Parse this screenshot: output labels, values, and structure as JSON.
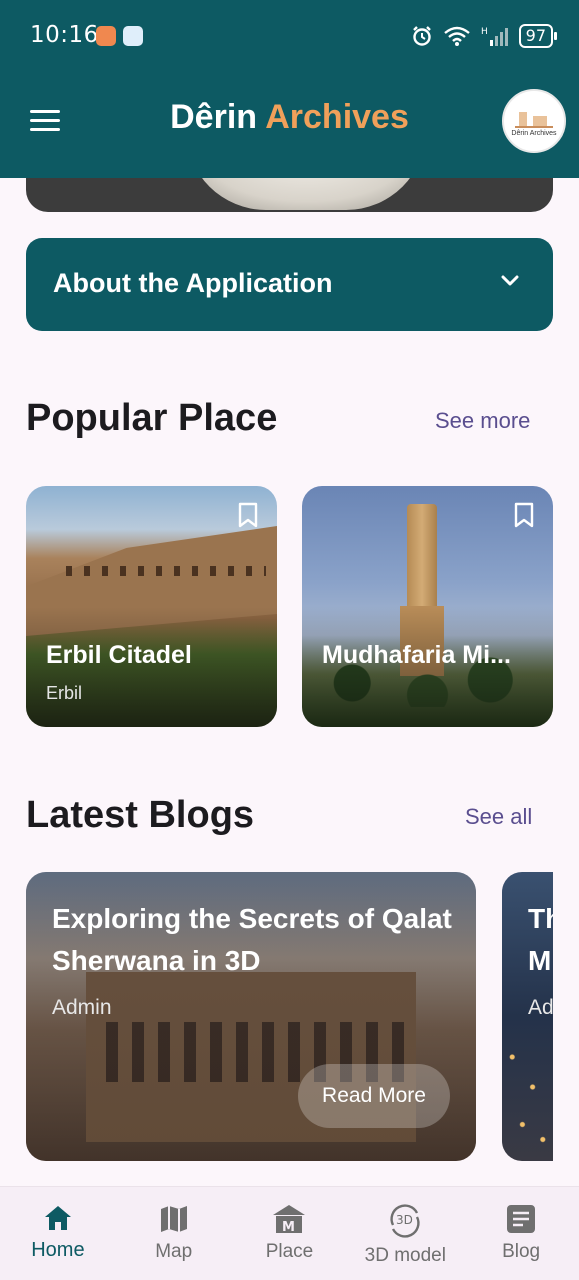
{
  "status_bar": {
    "time": "10:16",
    "battery": "97"
  },
  "app_bar": {
    "title_part1": "Dêrin",
    "title_part2": "Archives",
    "avatar_text": "Dêrin Archives"
  },
  "about": {
    "label": "About the Application"
  },
  "popular": {
    "title": "Popular Place",
    "see_more": "See more",
    "places": [
      {
        "name": "Erbil Citadel",
        "city": "Erbil"
      },
      {
        "name": "Mudhafaria Mi...",
        "city": ""
      }
    ]
  },
  "blogs": {
    "title": "Latest Blogs",
    "see_all": "See all",
    "items": [
      {
        "title": "Exploring the Secrets of Qalat Sherwana in 3D",
        "author": "Admin",
        "cta": "Read More"
      },
      {
        "title": "Th M",
        "author": "Ad"
      }
    ]
  },
  "bottom_nav": {
    "items": [
      {
        "label": "Home",
        "icon": "home-icon",
        "active": true
      },
      {
        "label": "Map",
        "icon": "map-icon"
      },
      {
        "label": "Place",
        "icon": "place-icon"
      },
      {
        "label": "3D model",
        "icon": "3d-model-icon"
      },
      {
        "label": "Blog",
        "icon": "blog-icon"
      }
    ]
  },
  "colors": {
    "primary": "#0d5a63",
    "accent": "#f0a05a",
    "link": "#5a4e8f",
    "background": "#fcf6fb"
  }
}
